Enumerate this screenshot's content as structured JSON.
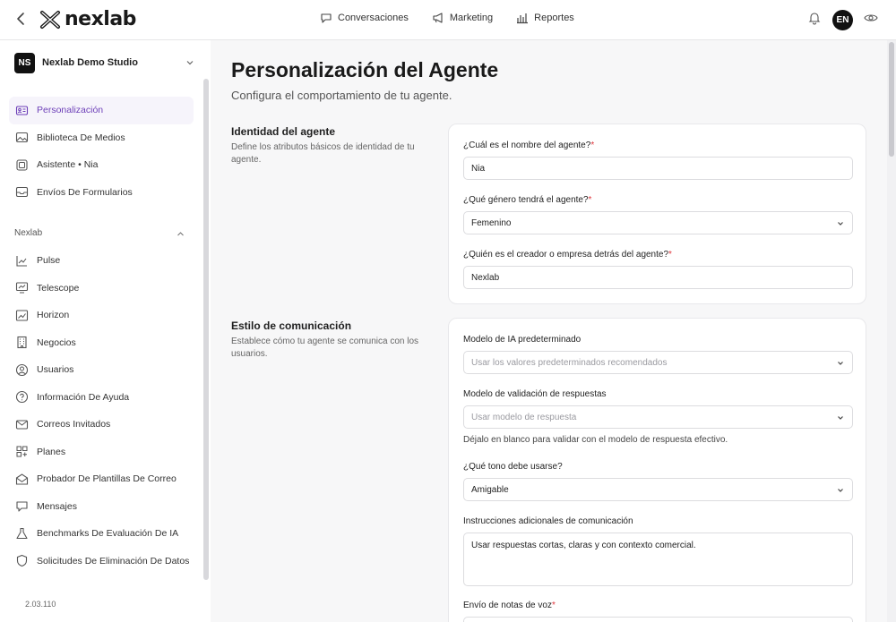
{
  "topbar": {
    "logo_text": "nexlab",
    "nav": [
      {
        "label": "Conversaciones",
        "icon": "chat-icon"
      },
      {
        "label": "Marketing",
        "icon": "megaphone-icon"
      },
      {
        "label": "Reportes",
        "icon": "bar-chart-icon"
      }
    ],
    "lang": "EN"
  },
  "sidebar": {
    "workspace_badge": "NS",
    "workspace_name": "Nexlab Demo Studio",
    "items": [
      {
        "label": "Personalización",
        "icon": "id-card-icon",
        "active": true
      },
      {
        "label": "Biblioteca De Medios",
        "icon": "image-icon"
      },
      {
        "label": "Asistente • Nia",
        "icon": "assistant-icon"
      },
      {
        "label": "Envíos De Formularios",
        "icon": "inbox-icon"
      }
    ],
    "section_label": "Nexlab",
    "section_items": [
      {
        "label": "Pulse",
        "icon": "chart-line-icon"
      },
      {
        "label": "Telescope",
        "icon": "monitor-chart-icon"
      },
      {
        "label": "Horizon",
        "icon": "trend-icon"
      },
      {
        "label": "Negocios",
        "icon": "building-icon"
      },
      {
        "label": "Usuarios",
        "icon": "user-circle-icon"
      },
      {
        "label": "Información De Ayuda",
        "icon": "help-circle-icon"
      },
      {
        "label": "Correos Invitados",
        "icon": "mail-icon"
      },
      {
        "label": "Planes",
        "icon": "grid-plus-icon"
      },
      {
        "label": "Probador De Plantillas De Correo",
        "icon": "mail-template-icon"
      },
      {
        "label": "Mensajes",
        "icon": "message-icon"
      },
      {
        "label": "Benchmarks De Evaluación De IA",
        "icon": "flask-icon"
      },
      {
        "label": "Solicitudes De Eliminación De Datos",
        "icon": "shield-icon"
      }
    ],
    "version": "2.03.110"
  },
  "main": {
    "title": "Personalización del Agente",
    "subtitle": "Configura el comportamiento de tu agente.",
    "identity": {
      "title": "Identidad del agente",
      "desc": "Define los atributos básicos de identidad de tu agente.",
      "name_label": "¿Cuál es el nombre del agente?",
      "name_value": "Nia",
      "gender_label": "¿Qué género tendrá el agente?",
      "gender_value": "Femenino",
      "creator_label": "¿Quién es el creador o empresa detrás del agente?",
      "creator_value": "Nexlab"
    },
    "communication": {
      "title": "Estilo de comunicación",
      "desc": "Establece cómo tu agente se comunica con los usuarios.",
      "model_label": "Modelo de IA predeterminado",
      "model_placeholder": "Usar los valores predeterminados recomendados",
      "validation_label": "Modelo de validación de respuestas",
      "validation_placeholder": "Usar modelo de respuesta",
      "validation_help": "Déjalo en blanco para validar con el modelo de respuesta efectivo.",
      "tone_label": "¿Qué tono debe usarse?",
      "tone_value": "Amigable",
      "instructions_label": "Instrucciones adicionales de comunicación",
      "instructions_value": "Usar respuestas cortas, claras y con contexto comercial.",
      "voice_label": "Envío de notas de voz"
    },
    "required_mark": "*"
  },
  "colors": {
    "accent": "#6d3fb8",
    "required": "#e0383e"
  }
}
